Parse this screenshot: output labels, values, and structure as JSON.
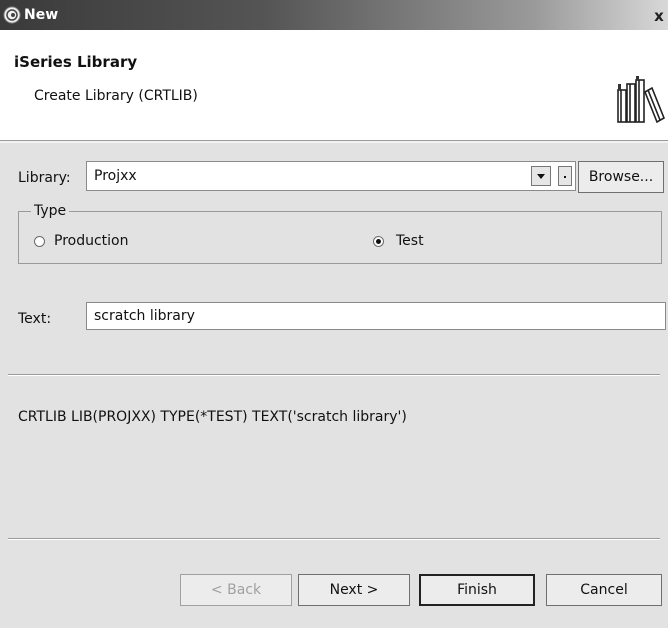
{
  "window": {
    "title": "New",
    "close_glyph": "x"
  },
  "header": {
    "title": "iSeries Library",
    "description": "Create Library (CRTLIB)",
    "graphic_icon": "library-books-icon"
  },
  "library": {
    "label": "Library:",
    "value": "Projxx",
    "browse_label": "Browse..."
  },
  "type": {
    "legend": "Type",
    "options": [
      {
        "label": "Production",
        "selected": false
      },
      {
        "label": "Test",
        "selected": true
      }
    ]
  },
  "text_field": {
    "label": "Text:",
    "value": "scratch library"
  },
  "command_preview": "CRTLIB LIB(PROJXX) TYPE(*TEST) TEXT('scratch library')",
  "buttons": {
    "back": "< Back",
    "next": "Next >",
    "finish": "Finish",
    "cancel": "Cancel"
  },
  "colors": {
    "dialog_bg": "#e2e2e2",
    "header_bg": "#ffffff",
    "disabled_text": "#a0a0a0"
  }
}
